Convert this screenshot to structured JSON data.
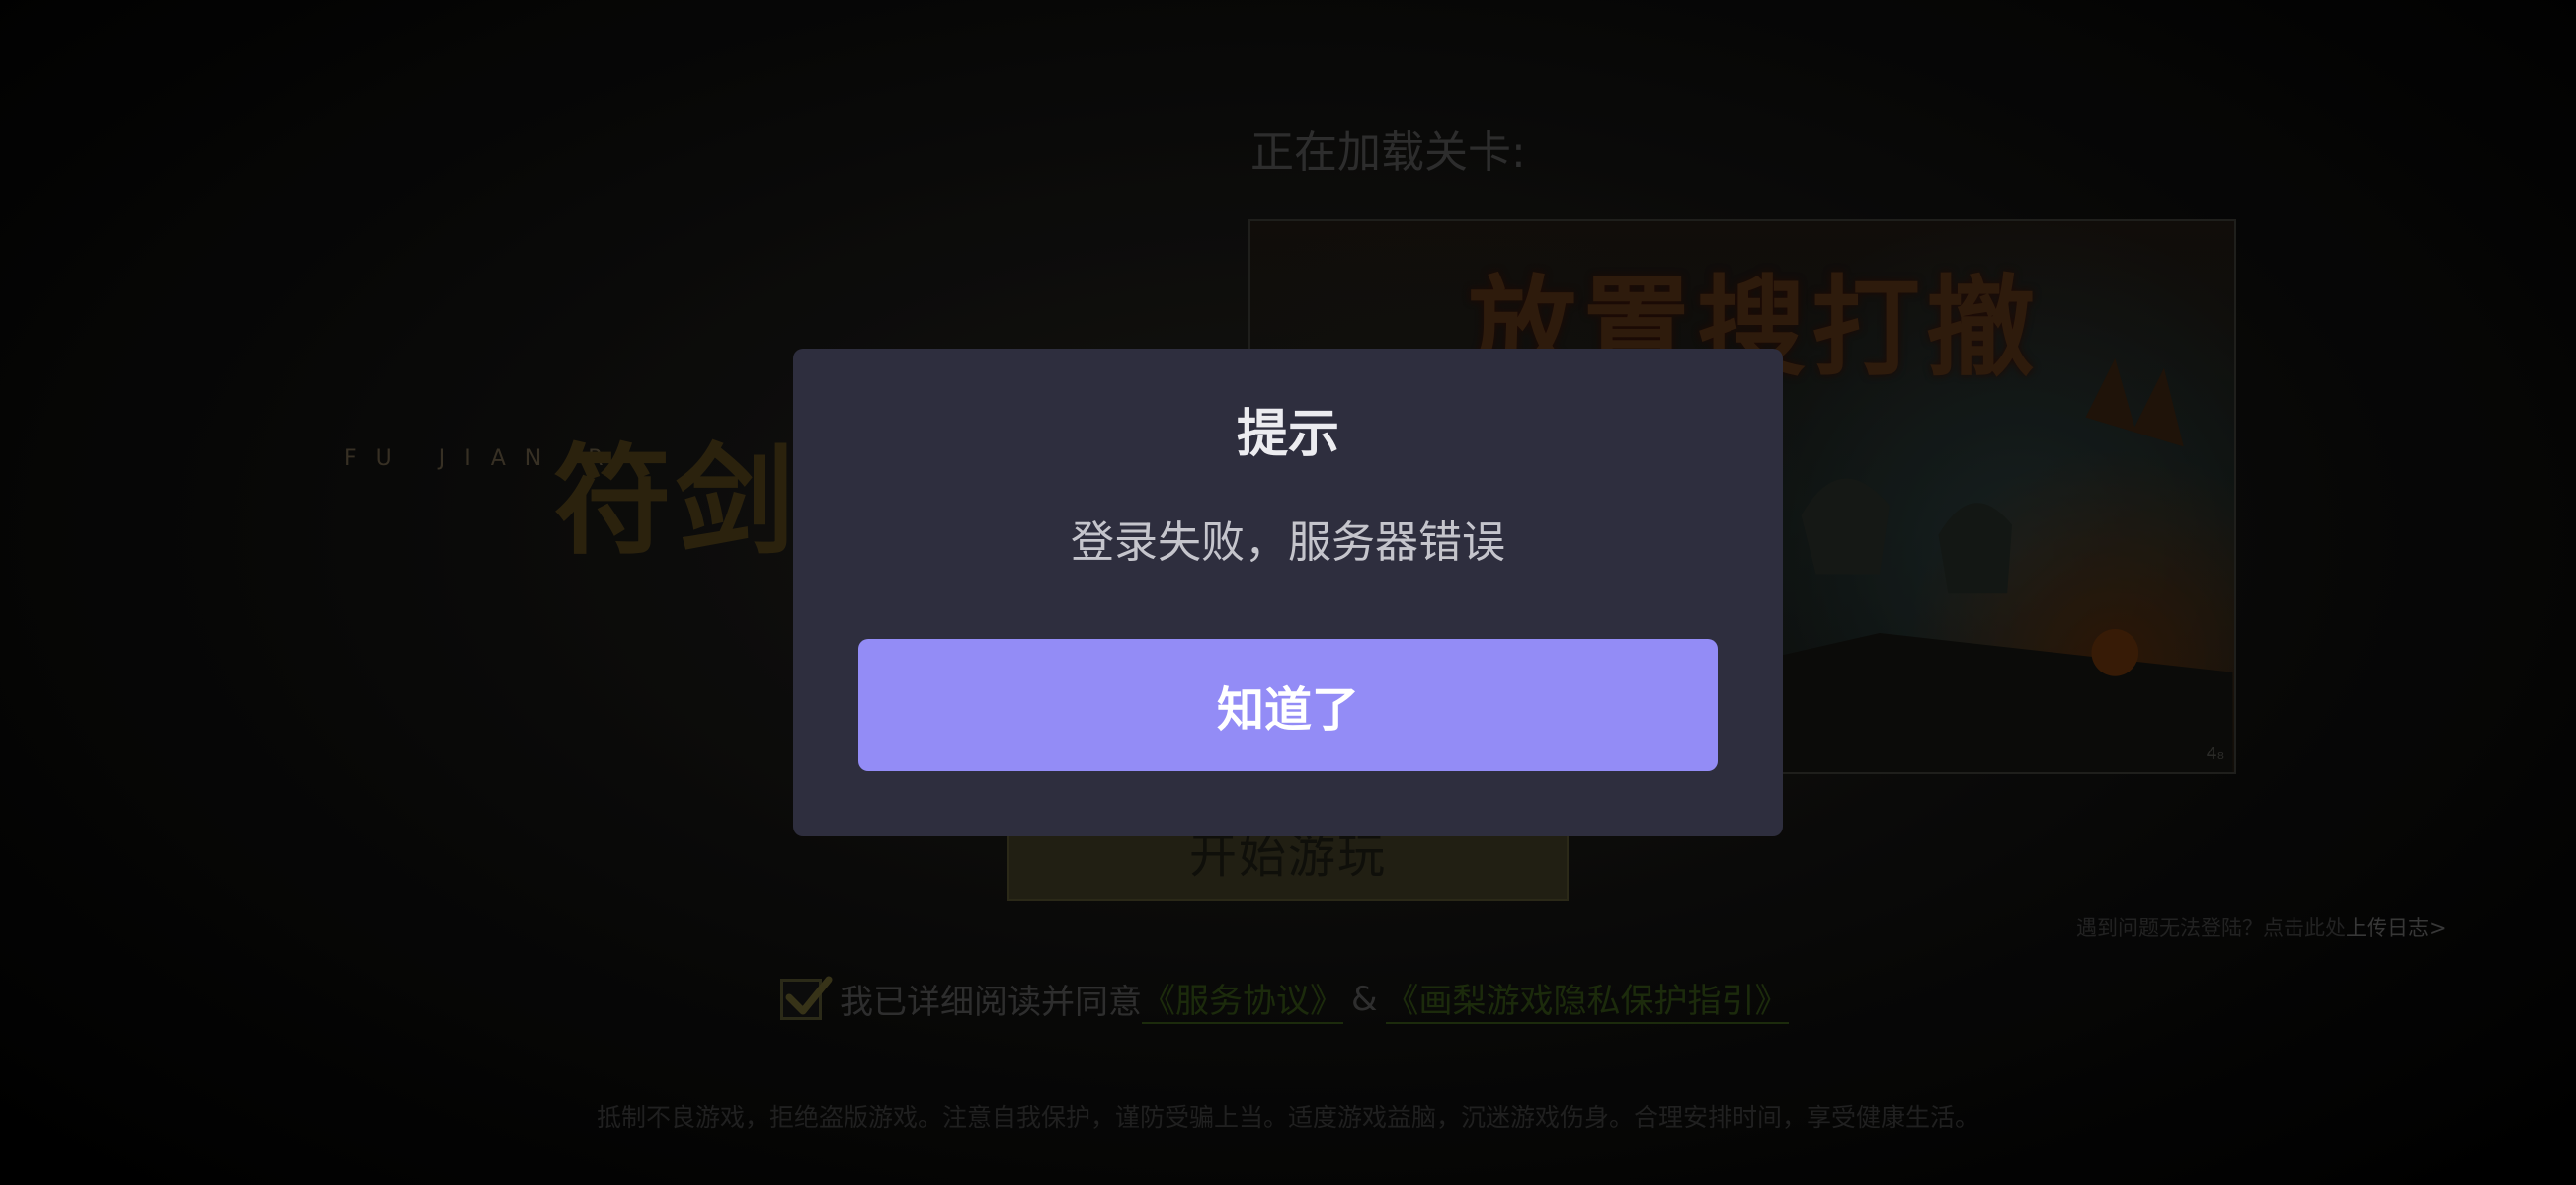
{
  "background": {
    "logo": {
      "latin_text": "FU JIAN R",
      "glyphs": "符剑"
    },
    "loading_label": "正在加载关卡:",
    "level_image": {
      "title_text": "放置搜打撤",
      "corner_mark": "4₈"
    },
    "start_button_label": "开始游玩",
    "report_link": {
      "prefix": "遇到问题无法登陆？点击此处",
      "action": "上传日志>"
    },
    "agreement": {
      "checked": true,
      "prefix": "我已详细阅读并同意",
      "service_link": "《服务协议》",
      "amp": "&",
      "privacy_link": "《画梨游戏隐私保护指引》"
    },
    "footer_note": "抵制不良游戏，拒绝盗版游戏。注意自我保护，谨防受骗上当。适度游戏益脑，沉迷游戏伤身。合理安排时间，享受健康生活。"
  },
  "dialog": {
    "title": "提示",
    "message": "登录失败，服务器错误",
    "button_label": "知道了",
    "button_color": "#938cf6",
    "background_color": "#2e2e3e"
  }
}
